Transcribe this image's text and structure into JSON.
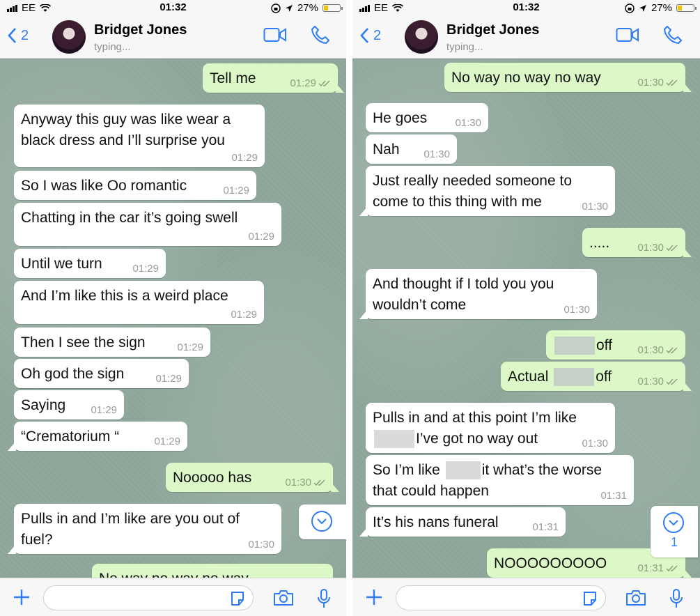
{
  "left": {
    "status": {
      "carrier": "EE",
      "time": "01:32",
      "battery": "27%"
    },
    "header": {
      "back_count": "2",
      "contact_name": "Bridget Jones",
      "contact_status": "typing..."
    },
    "messages": [
      {
        "dir": "out",
        "text": "Tell me",
        "time": "01:29"
      },
      {
        "dir": "in",
        "text": "Anyway this guy was like wear a\nblack dress and I’ll surprise you",
        "time": "01:29"
      },
      {
        "dir": "in",
        "text": "So I was like Oo romantic",
        "time": "01:29"
      },
      {
        "dir": "in",
        "text": "Chatting in the car it’s going swell",
        "time": "01:29"
      },
      {
        "dir": "in",
        "text": "Until we turn",
        "time": "01:29"
      },
      {
        "dir": "in",
        "text": "And I’m like this is a weird place",
        "time": "01:29"
      },
      {
        "dir": "in",
        "text": "Then I see the sign",
        "time": "01:29"
      },
      {
        "dir": "in",
        "text": "Oh god the sign",
        "time": "01:29"
      },
      {
        "dir": "in",
        "text": "Saying",
        "time": "01:29"
      },
      {
        "dir": "in",
        "text": "“Crematorium “",
        "time": "01:29"
      },
      {
        "dir": "out",
        "text": "Nooooo has",
        "time": "01:30"
      },
      {
        "dir": "in",
        "text": "Pulls in and I’m like are you out of\nfuel?",
        "time": "01:30"
      },
      {
        "dir": "out",
        "text": "No way no way no way",
        "time": ""
      }
    ]
  },
  "right": {
    "status": {
      "carrier": "EE",
      "time": "01:32",
      "battery": "27%"
    },
    "header": {
      "back_count": "2",
      "contact_name": "Bridget Jones",
      "contact_status": "typing..."
    },
    "messages": [
      {
        "dir": "out",
        "text": "No way no way no way",
        "time": "01:30"
      },
      {
        "dir": "in",
        "text": "He goes",
        "time": "01:30"
      },
      {
        "dir": "in",
        "text": "Nah",
        "time": "01:30"
      },
      {
        "dir": "in",
        "text": "Just really needed someone to\ncome to this thing with me",
        "time": "01:30"
      },
      {
        "dir": "out",
        "text": ".....",
        "time": "01:30"
      },
      {
        "dir": "in",
        "text": "And thought if I told you you\nwouldn’t come",
        "time": "01:30"
      },
      {
        "dir": "out",
        "text_after": "off",
        "time": "01:30"
      },
      {
        "dir": "out",
        "text_before": "Actual",
        "text_after": "off",
        "time": "01:30"
      },
      {
        "dir": "in",
        "line1": "Pulls in and at this point I’m like",
        "line2_after": "I’ve got no way out",
        "time": "01:30"
      },
      {
        "dir": "in",
        "line1_before": "So I’m like",
        "line1_after": "it what’s the worse",
        "line2": "that could happen",
        "time": "01:31"
      },
      {
        "dir": "in",
        "text": "It’s his nans funeral",
        "time": "01:31"
      },
      {
        "dir": "out",
        "text": "NOOOOOOOOO",
        "time": "01:31"
      }
    ],
    "unread_count": "1"
  }
}
